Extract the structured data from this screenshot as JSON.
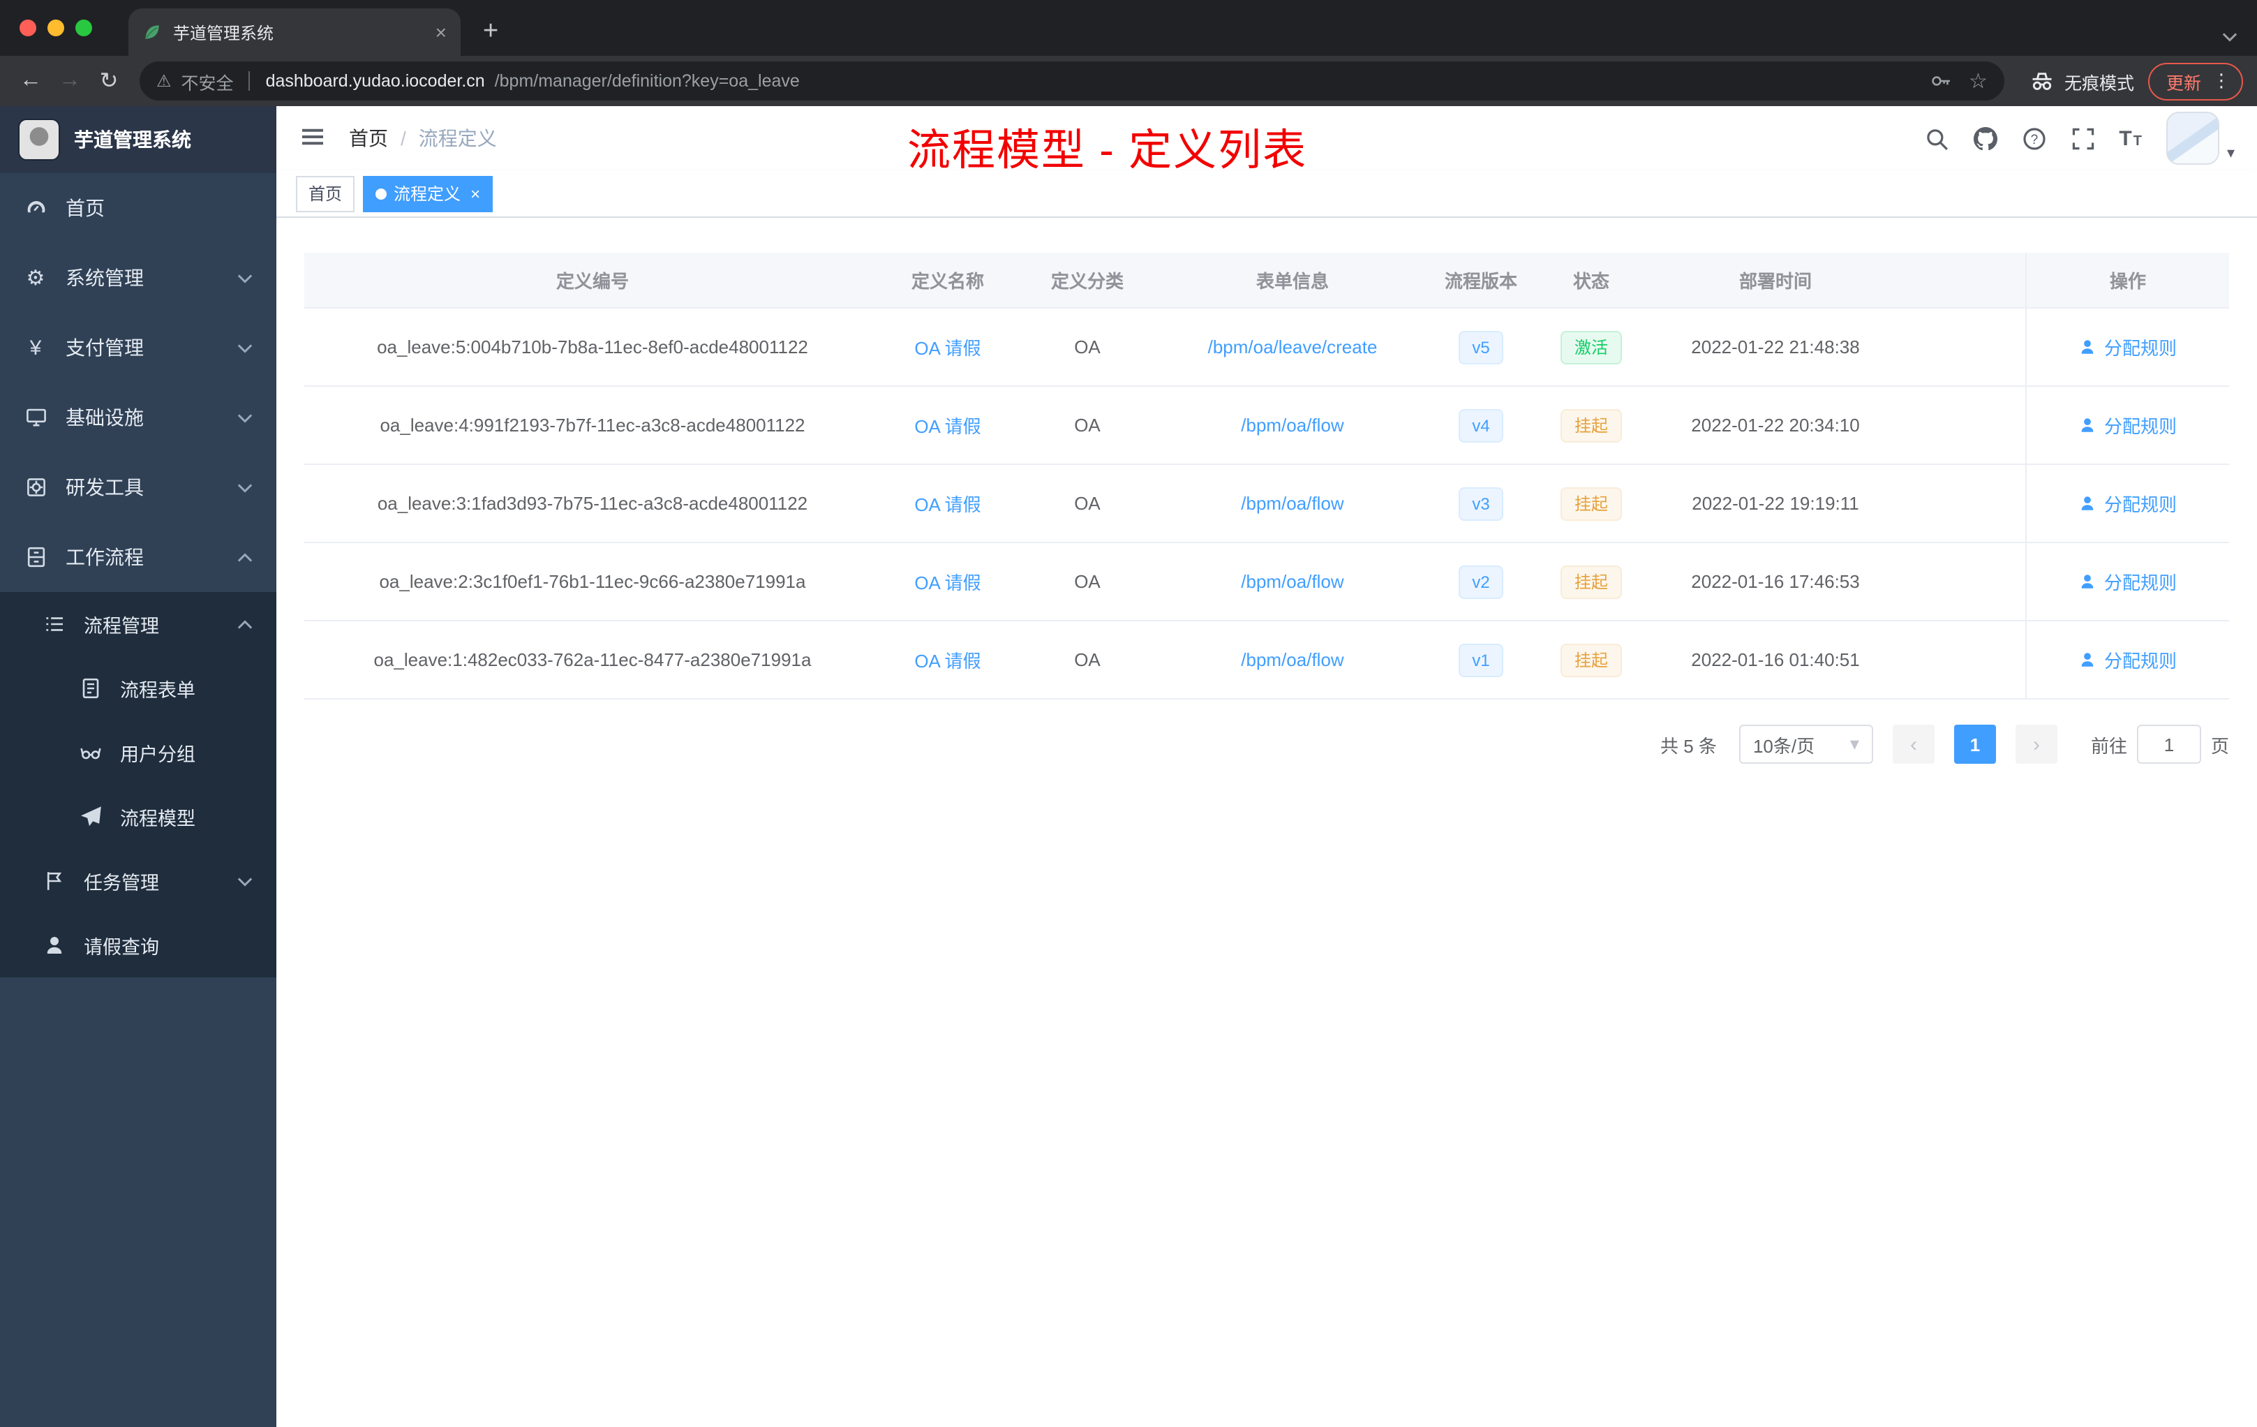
{
  "browser": {
    "tab_title": "芋道管理系统",
    "security_label": "不安全",
    "url_domain": "dashboard.yudao.iocoder.cn",
    "url_path": "/bpm/manager/definition?key=oa_leave",
    "incognito_label": "无痕模式",
    "update_label": "更新"
  },
  "annotation": {
    "text": "流程模型 - 定义列表",
    "color": "#f20000"
  },
  "sidebar": {
    "logo_title": "芋道管理系统",
    "items": [
      {
        "label": "首页",
        "icon": "dashboard-icon"
      },
      {
        "label": "系统管理",
        "icon": "gear-icon"
      },
      {
        "label": "支付管理",
        "icon": "yen-icon"
      },
      {
        "label": "基础设施",
        "icon": "infrastructure-icon"
      },
      {
        "label": "研发工具",
        "icon": "devtools-icon"
      },
      {
        "label": "工作流程",
        "icon": "workflow-icon"
      }
    ],
    "workflow": {
      "process_mgmt": {
        "label": "流程管理",
        "icon": "list-icon"
      },
      "process_children": [
        {
          "label": "流程表单",
          "icon": "form-icon"
        },
        {
          "label": "用户分组",
          "icon": "user-group-icon"
        },
        {
          "label": "流程模型",
          "icon": "paper-plane-icon"
        }
      ],
      "task_mgmt": {
        "label": "任务管理",
        "icon": "flag-icon"
      },
      "leave_query": {
        "label": "请假查询",
        "icon": "person-icon"
      }
    }
  },
  "navbar": {
    "breadcrumb": [
      "首页",
      "流程定义"
    ]
  },
  "tags": [
    {
      "label": "首页",
      "active": false
    },
    {
      "label": "流程定义",
      "active": true
    }
  ],
  "table": {
    "headers": [
      "定义编号",
      "定义名称",
      "定义分类",
      "表单信息",
      "流程版本",
      "状态",
      "部署时间",
      "操作"
    ],
    "rows": [
      {
        "id": "oa_leave:5:004b710b-7b8a-11ec-8ef0-acde48001122",
        "name": "OA 请假",
        "category": "OA",
        "form": "/bpm/oa/leave/create",
        "version": "v5",
        "status": "激活",
        "status_type": "success",
        "time": "2022-01-22 21:48:38",
        "action": "分配规则"
      },
      {
        "id": "oa_leave:4:991f2193-7b7f-11ec-a3c8-acde48001122",
        "name": "OA 请假",
        "category": "OA",
        "form": "/bpm/oa/flow",
        "version": "v4",
        "status": "挂起",
        "status_type": "warning",
        "time": "2022-01-22 20:34:10",
        "action": "分配规则"
      },
      {
        "id": "oa_leave:3:1fad3d93-7b75-11ec-a3c8-acde48001122",
        "name": "OA 请假",
        "category": "OA",
        "form": "/bpm/oa/flow",
        "version": "v3",
        "status": "挂起",
        "status_type": "warning",
        "time": "2022-01-22 19:19:11",
        "action": "分配规则"
      },
      {
        "id": "oa_leave:2:3c1f0ef1-76b1-11ec-9c66-a2380e71991a",
        "name": "OA 请假",
        "category": "OA",
        "form": "/bpm/oa/flow",
        "version": "v2",
        "status": "挂起",
        "status_type": "warning",
        "time": "2022-01-16 17:46:53",
        "action": "分配规则"
      },
      {
        "id": "oa_leave:1:482ec033-762a-11ec-8477-a2380e71991a",
        "name": "OA 请假",
        "category": "OA",
        "form": "/bpm/oa/flow",
        "version": "v1",
        "status": "挂起",
        "status_type": "warning",
        "time": "2022-01-16 01:40:51",
        "action": "分配规则"
      }
    ]
  },
  "pagination": {
    "total": "共 5 条",
    "page_size": "10条/页",
    "current_page": "1",
    "goto_label": "前往",
    "goto_value": "1",
    "page_unit": "页"
  },
  "colors": {
    "accent": "#409eff",
    "status_active": "#13ce66",
    "status_suspended": "#e6a23c",
    "annotation_red": "#f20000",
    "sidebar_bg": "#304156",
    "submenu_bg": "#1f2d3d"
  }
}
